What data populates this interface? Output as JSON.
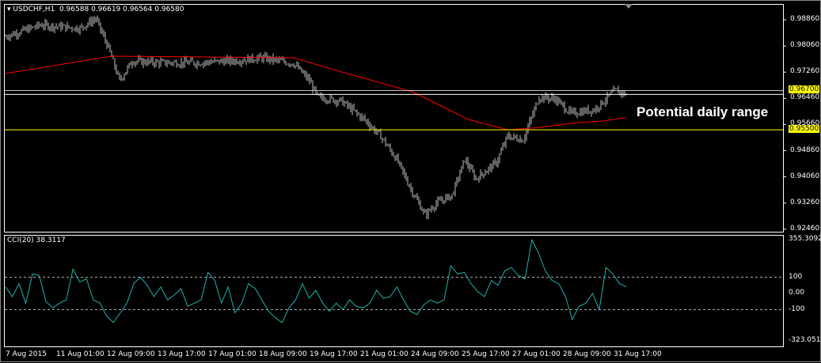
{
  "chart_data": [
    {
      "type": "bar",
      "title": "USDCHF,H1",
      "ohlc_readout": [
        "0.96588",
        "0.96619",
        "0.96564",
        "0.96580"
      ],
      "yticks": [
        "0.98860",
        "0.98060",
        "0.97260",
        "0.96460",
        "0.95660",
        "0.94860",
        "0.94060",
        "0.93260",
        "0.92460"
      ],
      "ylim": [
        0.9246,
        0.9886
      ],
      "price_levels": [
        {
          "label": "0.96700",
          "value": 0.967,
          "color": "#ffff00",
          "line_color": "#c0c0c0"
        },
        {
          "label": "0.95500",
          "value": 0.955,
          "color": "#ffff00",
          "line_color": "#ffff00"
        }
      ],
      "current_price": 0.9658,
      "annotation": "Potential daily range",
      "xticks": [
        "7 Aug 2015",
        "11 Aug 01:00",
        "12 Aug 09:00",
        "13 Aug 17:00",
        "17 Aug 01:00",
        "18 Aug 09:00",
        "19 Aug 17:00",
        "21 Aug 01:00",
        "24 Aug 09:00",
        "25 Aug 17:00",
        "27 Aug 01:00",
        "28 Aug 09:00",
        "31 Aug 17:00"
      ],
      "bars_per_tick": 32,
      "close_control": [
        [
          0,
          0.9835
        ],
        [
          22,
          0.987
        ],
        [
          47,
          0.986
        ],
        [
          57,
          0.989
        ],
        [
          65,
          0.98
        ],
        [
          72,
          0.97
        ],
        [
          80,
          0.976
        ],
        [
          97,
          0.9755
        ],
        [
          122,
          0.9755
        ],
        [
          147,
          0.9762
        ],
        [
          162,
          0.977
        ],
        [
          182,
          0.9752
        ],
        [
          192,
          0.97
        ],
        [
          197,
          0.965
        ],
        [
          212,
          0.9638
        ],
        [
          227,
          0.958
        ],
        [
          237,
          0.953
        ],
        [
          247,
          0.946
        ],
        [
          257,
          0.936
        ],
        [
          265,
          0.929
        ],
        [
          272,
          0.9326
        ],
        [
          282,
          0.935
        ],
        [
          290,
          0.946
        ],
        [
          297,
          0.94
        ],
        [
          310,
          0.945
        ],
        [
          317,
          0.953
        ],
        [
          327,
          0.952
        ],
        [
          337,
          0.965
        ],
        [
          347,
          0.9645
        ],
        [
          357,
          0.96
        ],
        [
          372,
          0.9612
        ],
        [
          385,
          0.967
        ],
        [
          392,
          0.9658
        ]
      ],
      "ma_color": "#ff0000",
      "ma_control": [
        [
          0,
          0.9722
        ],
        [
          67,
          0.9775
        ],
        [
          182,
          0.977
        ],
        [
          212,
          0.9727
        ],
        [
          257,
          0.9666
        ],
        [
          292,
          0.9582
        ],
        [
          317,
          0.955
        ],
        [
          337,
          0.9557
        ],
        [
          357,
          0.957
        ],
        [
          377,
          0.9577
        ],
        [
          392,
          0.9587
        ]
      ]
    },
    {
      "type": "line",
      "title": "CCI(20) 38.3117",
      "yticks": [
        "355.3092",
        "100",
        "0.00",
        "-100",
        "-323.0518"
      ],
      "ylim": [
        -323.0518,
        355.3092
      ],
      "levels": [
        100,
        -100
      ],
      "color": "#20b2aa",
      "values": [
        40,
        -20,
        60,
        -60,
        120,
        110,
        -50,
        -90,
        -60,
        -40,
        150,
        70,
        90,
        -40,
        -60,
        -140,
        -180,
        -120,
        -60,
        60,
        100,
        50,
        -20,
        40,
        -40,
        -10,
        30,
        -80,
        -60,
        -40,
        130,
        80,
        -60,
        40,
        -120,
        -60,
        60,
        30,
        -40,
        -110,
        -150,
        -180,
        -90,
        -40,
        60,
        -30,
        20,
        -60,
        -110,
        -60,
        -100,
        -40,
        -80,
        -90,
        -60,
        20,
        -30,
        -20,
        40,
        -40,
        -110,
        -130,
        -70,
        -40,
        -60,
        -40,
        170,
        120,
        130,
        60,
        10,
        -20,
        80,
        50,
        140,
        160,
        110,
        90,
        330,
        250,
        140,
        80,
        60,
        -20,
        -160,
        -80,
        -60,
        0,
        -100,
        160,
        120,
        60,
        40
      ]
    }
  ]
}
